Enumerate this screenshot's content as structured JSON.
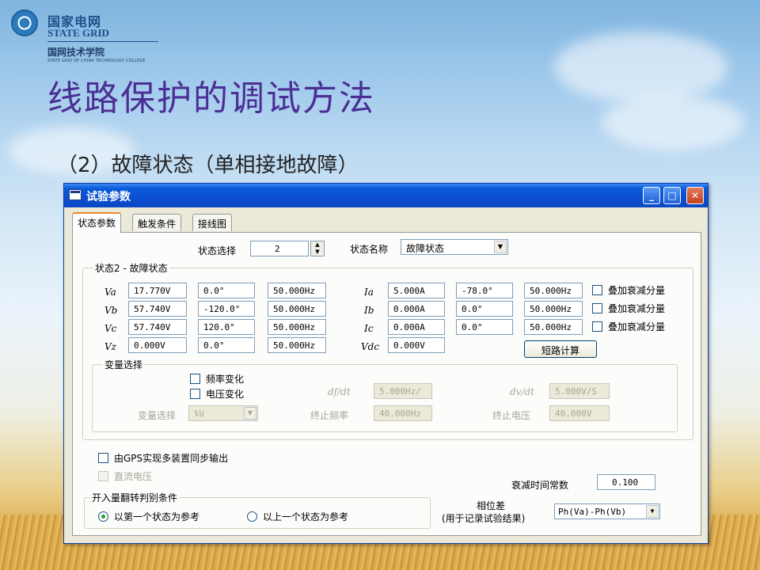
{
  "logo": {
    "company_cn": "国家电网",
    "company_en": "STATE GRID",
    "college_cn": "国网技术学院",
    "college_en": "STATE GRID OF CHINA TECHNOLOGY COLLEGE"
  },
  "slide": {
    "title": "线路保护的调试方法",
    "subtitle": "（2）故障状态（单相接地故障）"
  },
  "window": {
    "title": "试验参数",
    "controls": {
      "minimize": "_",
      "maximize": "□",
      "close": "✕"
    }
  },
  "tabs": [
    {
      "label": "状态参数",
      "active": true
    },
    {
      "label": "触发条件",
      "active": false
    },
    {
      "label": "接线图",
      "active": false
    }
  ],
  "state_select": {
    "label": "状态选择",
    "value": "2"
  },
  "state_name": {
    "label": "状态名称",
    "value": "故障状态"
  },
  "state_group_title": "状态2 - 故障状态",
  "voltages": [
    {
      "label": "Va",
      "amplitude": "17.770V",
      "angle": "0.0°",
      "frequency": "50.000Hz"
    },
    {
      "label": "Vb",
      "amplitude": "57.740V",
      "angle": "-120.0°",
      "frequency": "50.000Hz"
    },
    {
      "label": "Vc",
      "amplitude": "57.740V",
      "angle": "120.0°",
      "frequency": "50.000Hz"
    },
    {
      "label": "Vz",
      "amplitude": "0.000V",
      "angle": "0.0°",
      "frequency": "50.000Hz"
    }
  ],
  "currents": [
    {
      "label": "Ia",
      "amplitude": "5.000A",
      "angle": "-78.0°",
      "frequency": "50.000Hz",
      "decay_label": "叠加衰减分量",
      "decay_checked": false
    },
    {
      "label": "Ib",
      "amplitude": "0.000A",
      "angle": "0.0°",
      "frequency": "50.000Hz",
      "decay_label": "叠加衰减分量",
      "decay_checked": false
    },
    {
      "label": "Ic",
      "amplitude": "0.000A",
      "angle": "0.0°",
      "frequency": "50.000Hz",
      "decay_label": "叠加衰减分量",
      "decay_checked": false
    }
  ],
  "vdc": {
    "label": "Vdc",
    "value": "0.000V"
  },
  "short_circuit_button": "短路计算",
  "variable": {
    "title": "变量选择",
    "freq_change": "频率变化",
    "volt_change": "电压变化",
    "df_dt_label": "df/dt",
    "df_dt_value": "5.000Hz/",
    "dv_dt_label": "dv/dt",
    "dv_dt_value": "5.000V/S",
    "var_select_label": "变量选择",
    "var_select_value": "Va",
    "end_freq_label": "终止频率",
    "end_freq_value": "40.000Hz",
    "end_volt_label": "终止电压",
    "end_volt_value": "40.000V"
  },
  "gps_sync": "由GPS实现多装置同步输出",
  "dc_voltage": "直流电压",
  "decay_time": {
    "label": "衰减时间常数",
    "value": "0.100"
  },
  "switch_group": {
    "title": "开入量翻转判别条件",
    "option1": "以第一个状态为参考",
    "option2": "以上一个状态为参考"
  },
  "phase_diff": {
    "label_line1": "相位差",
    "label_line2": "(用于记录试验结果)",
    "value": "Ph(Va)-Ph(Vb)"
  }
}
